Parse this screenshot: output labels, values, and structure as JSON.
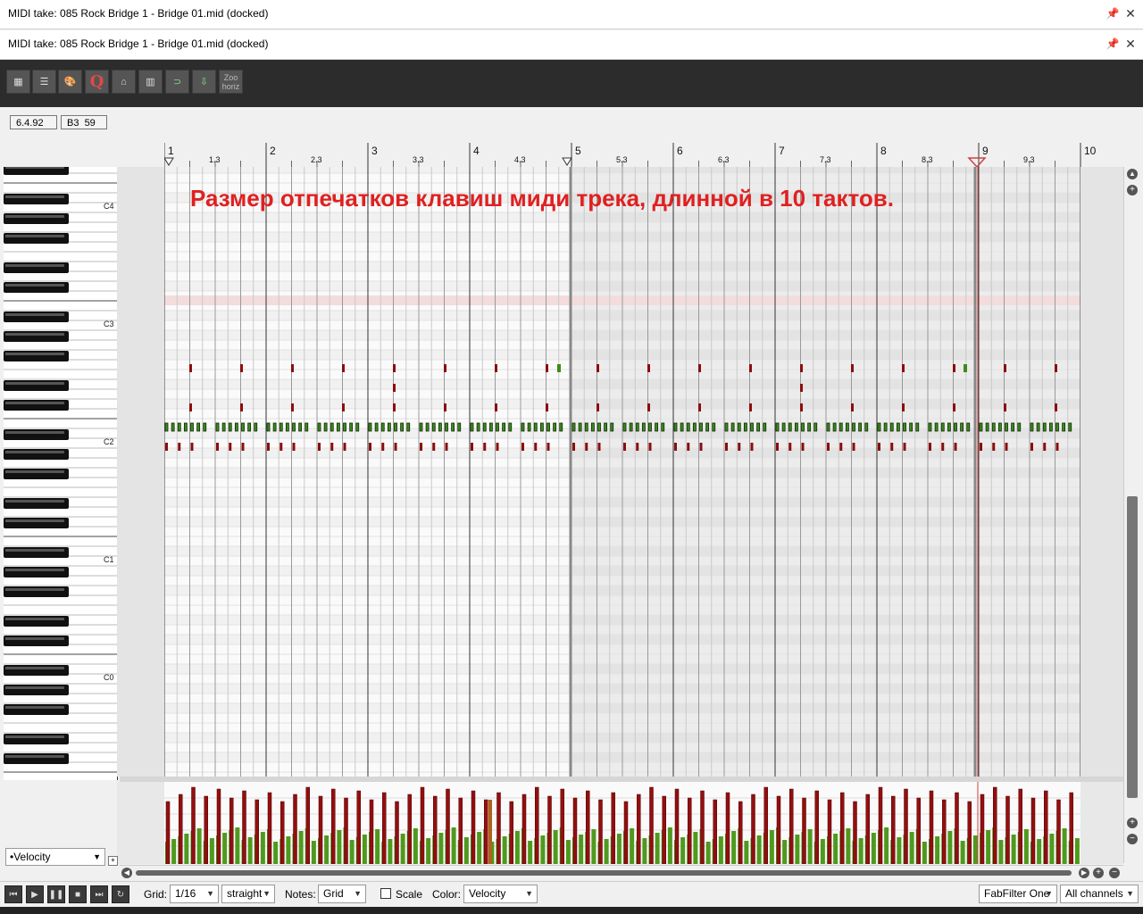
{
  "windows": {
    "outer_title": "MIDI take: 085 Rock Bridge 1 - Bridge 01.mid (docked)",
    "inner_title": "MIDI take: 085 Rock Bridge 1 - Bridge 01.mid (docked)"
  },
  "toolbar": {
    "buttons": [
      {
        "name": "event-list-view-button",
        "icon": "list-grid-icon",
        "label": ""
      },
      {
        "name": "named-notes-button",
        "icon": "lines-icon",
        "label": ""
      },
      {
        "name": "color-palette-button",
        "icon": "palette-icon",
        "label": ""
      },
      {
        "name": "quantize-button",
        "icon": "q-icon",
        "label": "Q"
      },
      {
        "name": "snap-button",
        "icon": "snap-icon",
        "label": ""
      },
      {
        "name": "grid-button",
        "icon": "grid-icon",
        "label": ""
      },
      {
        "name": "loop-button",
        "icon": "loop-icon",
        "label": ""
      },
      {
        "name": "follow-button",
        "icon": "follow-icon",
        "label": ""
      }
    ],
    "zoom_label_top": "Zoo",
    "zoom_label_bottom": "horiz"
  },
  "info": {
    "position": "6.4.92",
    "note": "B3  59"
  },
  "ruler": {
    "bars": [
      "1",
      "2",
      "3",
      "4",
      "5",
      "6",
      "7",
      "8",
      "9",
      "10"
    ],
    "subdivisions": [
      "1.3",
      "2.3",
      "3.3",
      "4.3",
      "5.3",
      "6.3",
      "7.3",
      "8.3",
      "9.3"
    ]
  },
  "piano": {
    "octave_labels": [
      "C4",
      "C3",
      "C2",
      "C1",
      "C0"
    ]
  },
  "overlay": {
    "annotation": "Размер отпечатков клавиш миди трека, длинной в 10 тактов."
  },
  "lane": {
    "selector": "•Velocity"
  },
  "transport": {
    "buttons": [
      "go-start",
      "play",
      "pause",
      "stop",
      "go-end",
      "record-loop"
    ]
  },
  "bottombar": {
    "grid_label": "Grid:",
    "grid_value": "1/16",
    "swing_value": "straight",
    "notes_label": "Notes:",
    "notes_value": "Grid",
    "scale_label": "Scale",
    "color_label": "Color:",
    "color_value": "Velocity",
    "instrument_value": "FabFilter One",
    "channel_value": "All channels"
  },
  "colors": {
    "note_red": "#8b0d0d",
    "note_green": "#3d8a1c",
    "playhead": "#d04040",
    "highlight_row": "#f3dcdc",
    "annotation": "#e02020"
  }
}
